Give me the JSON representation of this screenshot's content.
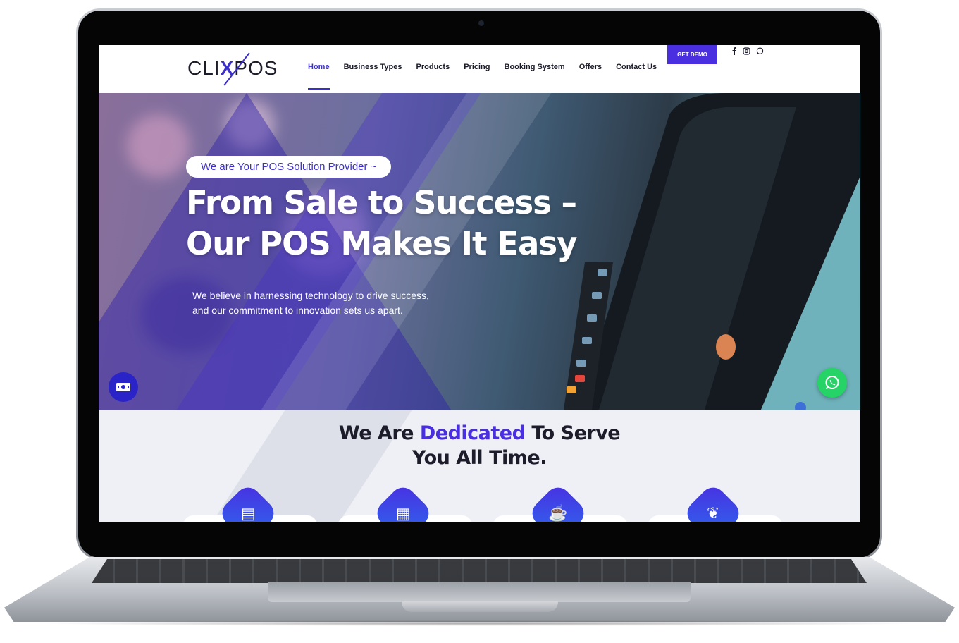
{
  "brand": {
    "logo_left": "CLI",
    "logo_x": "X",
    "logo_right": "POS"
  },
  "nav": {
    "items": [
      "Home",
      "Business Types",
      "Products",
      "Pricing",
      "Booking System",
      "Offers",
      "Contact Us"
    ],
    "active": "Home",
    "demo_label": "GET DEMO",
    "social_icons": [
      "facebook-icon",
      "instagram-icon",
      "whatsapp-icon"
    ]
  },
  "hero": {
    "badge": "We are Your POS Solution Provider ~",
    "headline_line1": "From Sale to Success –",
    "headline_line2": "Our POS Makes It Easy",
    "sub_line1": "We believe in harnessing technology to drive success,",
    "sub_line2": "and our commitment to innovation sets us apart."
  },
  "section": {
    "title_before": "We Are ",
    "title_highlight": "Dedicated",
    "title_after": " To Serve",
    "title_line2": "You All Time.",
    "feature_icons": [
      "store-icon",
      "building-icon",
      "coffee-cup-icon",
      "spa-leaf-icon"
    ]
  },
  "floating": {
    "cash_icon": "cash-icon",
    "chat_icon": "whatsapp-chat-icon"
  },
  "colors": {
    "accent": "#4a2fe0",
    "whatsapp": "#25d366",
    "text_dark": "#1c1c2a"
  }
}
